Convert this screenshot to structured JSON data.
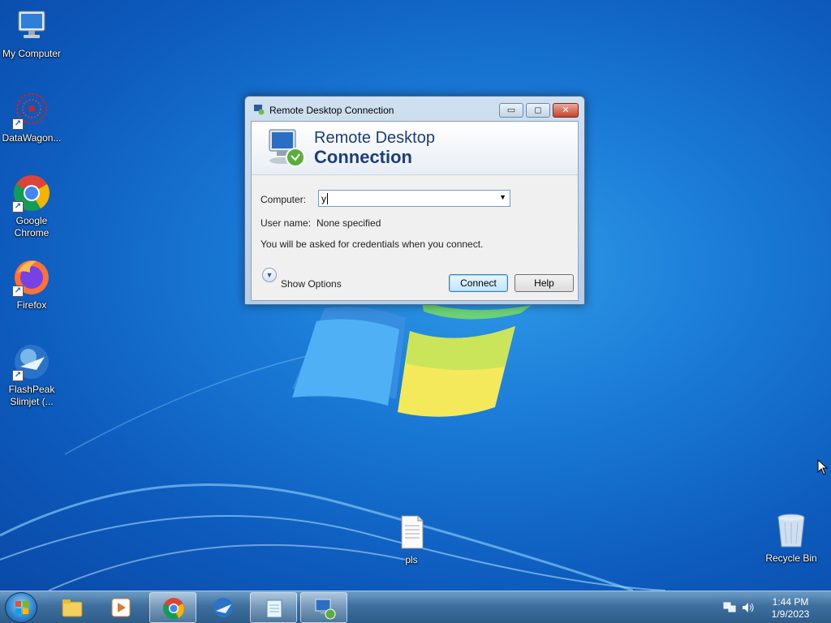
{
  "desktop": {
    "icons": [
      {
        "label": "My Computer"
      },
      {
        "label": "DataWagon..."
      },
      {
        "label": "Google Chrome"
      },
      {
        "label": "Firefox"
      },
      {
        "label": "FlashPeak Slimjet (..."
      },
      {
        "label": "pls"
      },
      {
        "label": "Recycle Bin"
      }
    ]
  },
  "window": {
    "title": "Remote Desktop Connection",
    "banner_line1": "Remote Desktop",
    "banner_line2": "Connection",
    "computer_label": "Computer:",
    "computer_value": "y",
    "username_label": "User name:",
    "username_value": "None specified",
    "info_text": "You will be asked for credentials when you connect.",
    "show_options": "Show Options",
    "connect_button": "Connect",
    "help_button": "Help",
    "minimize_glyph": "▭",
    "maximize_glyph": "◻",
    "close_glyph": "✕"
  },
  "taskbar": {
    "clock_time": "1:44 PM",
    "clock_date": "1/9/2023",
    "items": [
      "start-button",
      "windows-explorer",
      "media-player",
      "google-chrome",
      "slimjet-browser",
      "notepad",
      "remote-desktop-connection"
    ],
    "active_item": "remote-desktop-connection"
  },
  "colors": {
    "desktop_blue": "#1a7ad6",
    "banner_text": "#1c3d7a",
    "close_red": "#c6432c"
  }
}
